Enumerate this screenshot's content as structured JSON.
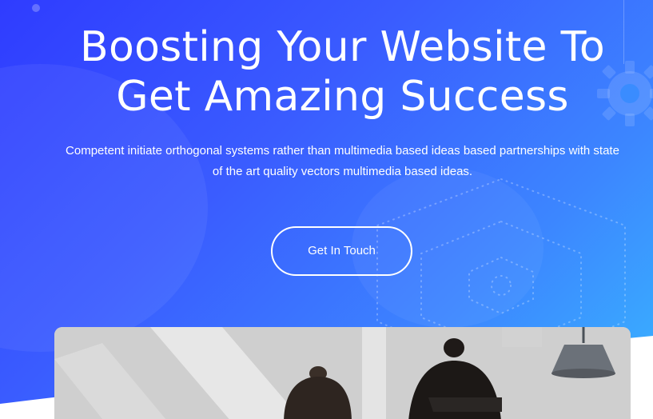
{
  "hero": {
    "title_line1": "Boosting Your Website To",
    "title_line2": "Get Amazing Success",
    "subtitle_line1": "Competent initiate orthogonal systems rather than multimedia based ideas based partnerships with state",
    "subtitle_line2": "of the art quality vectors multimedia based ideas.",
    "cta_label": "Get In Touch"
  },
  "colors": {
    "gradient_start": "#2f3cff",
    "gradient_end": "#39b6ff",
    "text": "#ffffff"
  },
  "icons": {
    "decor": "gear-icon"
  }
}
